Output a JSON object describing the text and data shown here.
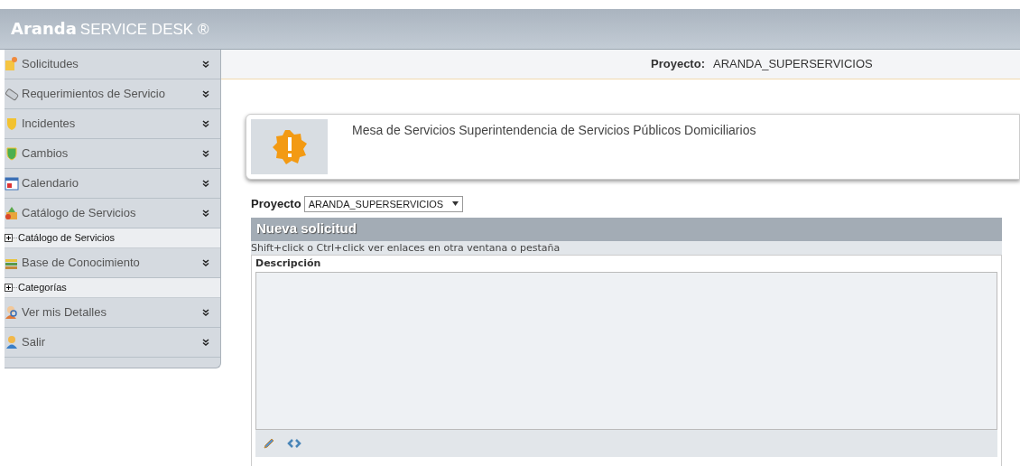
{
  "header": {
    "brand_bold": "Aranda",
    "brand_rest": "SERVICE DESK ®"
  },
  "sidebar": {
    "items": [
      {
        "kind": "section",
        "label": "Solicitudes"
      },
      {
        "kind": "section",
        "label": "Requerimientos de Servicio"
      },
      {
        "kind": "section",
        "label": "Incidentes"
      },
      {
        "kind": "section",
        "label": "Cambios"
      },
      {
        "kind": "section",
        "label": "Calendario"
      },
      {
        "kind": "section",
        "label": "Catálogo de Servicios"
      },
      {
        "kind": "node",
        "label": "Catálogo de Servicios"
      },
      {
        "kind": "section",
        "label": "Base de Conocimiento"
      },
      {
        "kind": "node",
        "label": "Categorías"
      },
      {
        "kind": "section",
        "label": "Ver mis Detalles"
      },
      {
        "kind": "section",
        "label": "Salir"
      }
    ]
  },
  "topbar": {
    "project_label": "Proyecto:",
    "project_value": "ARANDA_SUPERSERVICIOS"
  },
  "notice": {
    "message": "Mesa de Servicios Superintendencia de Servicios Públicos Domiciliarios"
  },
  "form": {
    "project_label": "Proyecto",
    "project_value": "ARANDA_SUPERSERVICIOS",
    "title": "Nueva solicitud",
    "hint": "Shift+click o Ctrl+click ver enlaces en otra ventana o pestaña",
    "description_label": "Descripción"
  }
}
